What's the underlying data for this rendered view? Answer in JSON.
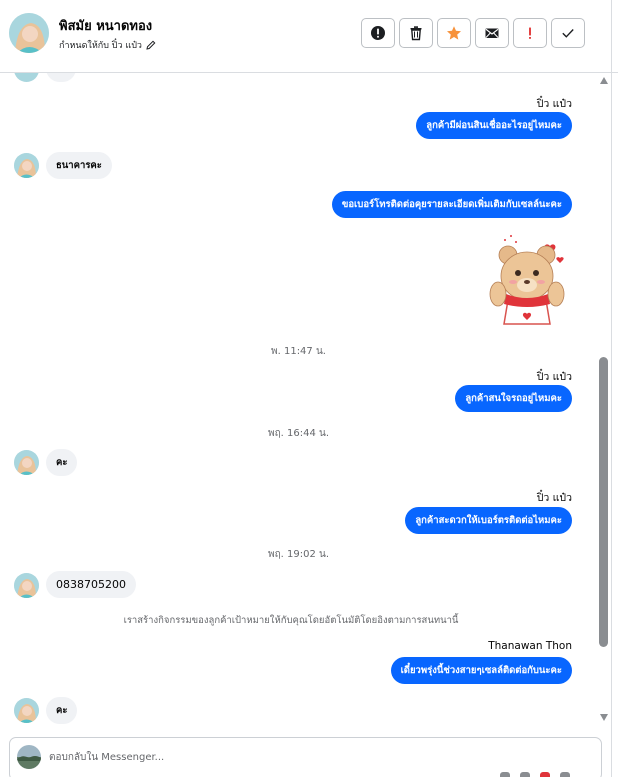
{
  "header": {
    "contact_name": "พิสมัย หนาดทอง",
    "assigned_label": "กำหนดให้กับ ปิ๋ว แป๋ว",
    "toolbar": [
      {
        "name": "spam-icon",
        "symbol": "info-circle"
      },
      {
        "name": "trash-icon",
        "symbol": "trash"
      },
      {
        "name": "star-icon",
        "symbol": "star"
      },
      {
        "name": "mail-icon",
        "symbol": "envelope"
      },
      {
        "name": "important-icon",
        "symbol": "exclamation"
      },
      {
        "name": "check-icon",
        "symbol": "check"
      }
    ]
  },
  "messages": {
    "sender_1": "ปิ๋ว แป๋ว",
    "out_1": "ลูกค้ามีผ่อนสินเชื่ออะไรอยู่ไหมคะ",
    "in_1": "ธนาคารคะ",
    "out_2": "ขอเบอร์โทรติดต่อคุยรายละเอียดเพิ่มเติมกับเซลล์นะคะ",
    "time_1": "พ. 11:47 น.",
    "sender_2": "ปิ๋ว แป๋ว",
    "out_3": "ลูกค้าสนใจรถอยู่ไหมคะ",
    "time_2": "พฤ. 16:44 น.",
    "in_2": "คะ",
    "sender_3": "ปิ๋ว แป๋ว",
    "out_4": "ลูกค้าสะดวกให้เบอร์ตรติดต่อไหมคะ",
    "time_3": "พฤ. 19:02 น.",
    "in_3": "0838705200",
    "system_note": "เราสร้างกิจกรรมของลูกค้าเป้าหมายให้กับคุณโดยอัตโนมัติโดยอิงตามการสนทนานี้",
    "sender_4": "Thanawan Thon",
    "out_5": "เดี๋ยวพรุ่งนี้ช่วงสายๆเซลล์ติดต่อกับนะคะ",
    "in_4": "คะ"
  },
  "composer": {
    "placeholder": "ตอบกลับใน Messenger..."
  },
  "colors": {
    "accent": "#0866ff",
    "incoming": "#f0f2f5",
    "star": "#f7923b",
    "important": "#e02d2d"
  }
}
